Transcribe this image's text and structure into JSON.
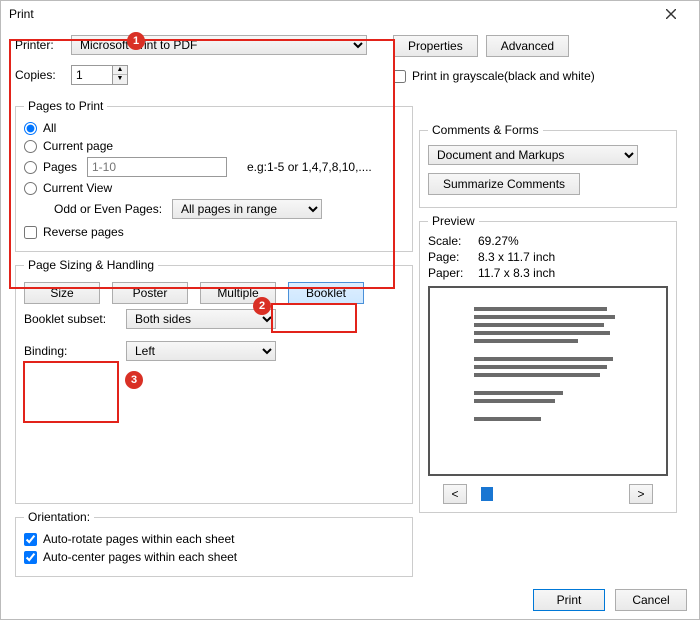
{
  "window": {
    "title": "Print"
  },
  "printer": {
    "label": "Printer:",
    "selected": "Microsoft Print to PDF",
    "properties": "Properties",
    "advanced": "Advanced"
  },
  "copies": {
    "label": "Copies:",
    "value": "1"
  },
  "grayscale": {
    "label": "Print in grayscale(black and white)"
  },
  "pages": {
    "legend": "Pages to Print",
    "all": "All",
    "current": "Current page",
    "range_label": "Pages",
    "range_placeholder": "1-10",
    "range_hint": "e.g:1-5 or 1,4,7,8,10,....",
    "current_view": "Current View",
    "odd_even_label": "Odd or Even Pages:",
    "odd_even_value": "All pages in range",
    "reverse": "Reverse pages"
  },
  "handling": {
    "legend": "Page Sizing & Handling",
    "size": "Size",
    "poster": "Poster",
    "multiple": "Multiple",
    "booklet": "Booklet",
    "subset_label": "Booklet subset:",
    "subset_value": "Both sides",
    "binding_label": "Binding:",
    "binding_value": "Left"
  },
  "orientation": {
    "legend": "Orientation:",
    "auto_rotate": "Auto-rotate pages within each sheet",
    "auto_center": "Auto-center pages within each sheet"
  },
  "comments": {
    "legend": "Comments & Forms",
    "value": "Document and Markups",
    "summarize": "Summarize Comments"
  },
  "preview": {
    "legend": "Preview",
    "scale_label": "Scale:",
    "scale_value": "69.27%",
    "page_label": "Page:",
    "page_value": "8.3 x 11.7 inch",
    "paper_label": "Paper:",
    "paper_value": "11.7 x 8.3 inch",
    "prev": "<",
    "next": ">"
  },
  "footer": {
    "print": "Print",
    "cancel": "Cancel"
  }
}
